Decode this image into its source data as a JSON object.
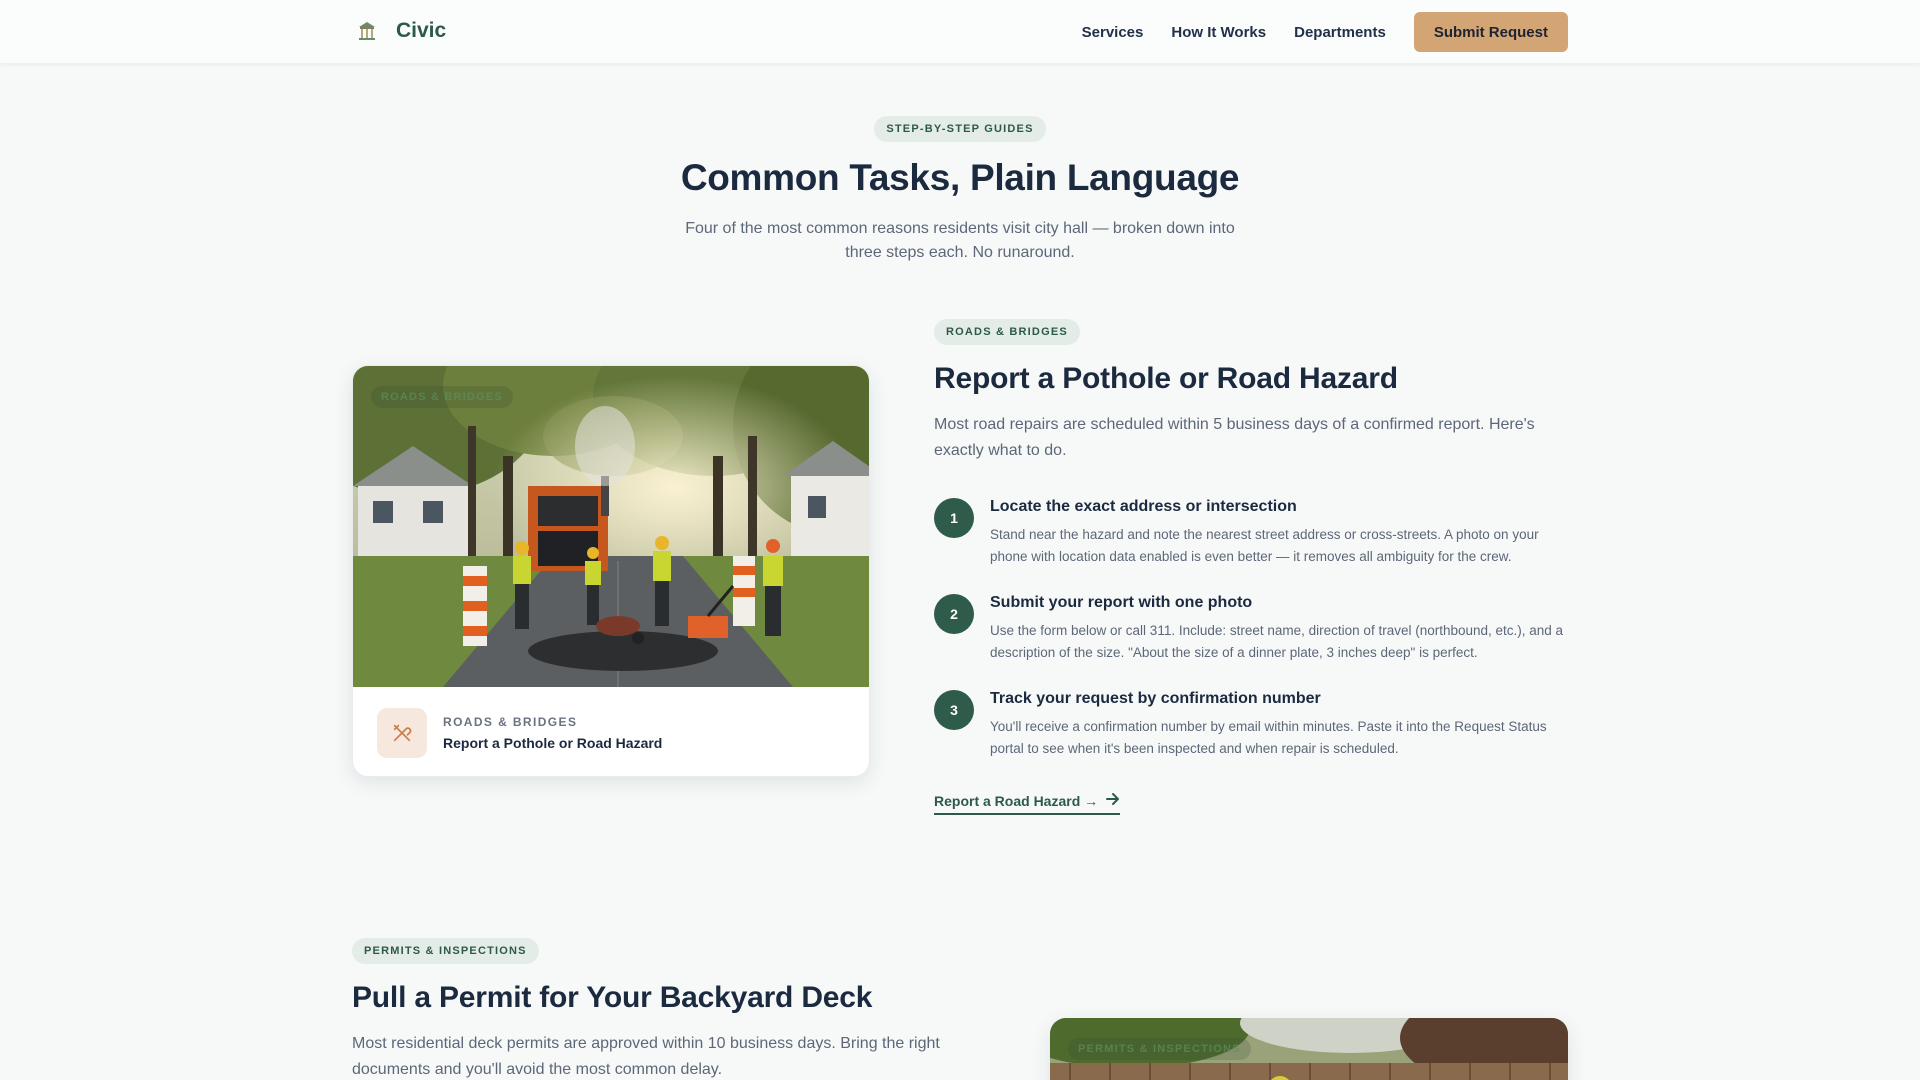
{
  "header": {
    "brand": "Civic",
    "nav": [
      "Services",
      "How It Works",
      "Departments"
    ],
    "cta": "Submit Request"
  },
  "intro": {
    "pill": "STEP-BY-STEP GUIDES",
    "title": "Common Tasks, Plain Language",
    "subtitle": "Four of the most common reasons residents visit city hall — broken down into three steps each. No runaround."
  },
  "task1": {
    "category": "ROADS & BRIDGES",
    "image_tag": "ROADS & BRIDGES",
    "card_category": "ROADS & BRIDGES",
    "card_title": "Report a Pothole or Road Hazard",
    "title": "Report a Pothole or Road Hazard",
    "lead": "Most road repairs are scheduled within 5 business days of a confirmed report. Here's exactly what to do.",
    "steps": [
      {
        "num": "1",
        "title": "Locate the exact address or intersection",
        "text": "Stand near the hazard and note the nearest street address or cross-streets. A photo on your phone with location data enabled is even better — it removes all ambiguity for the crew."
      },
      {
        "num": "2",
        "title": "Submit your report with one photo",
        "text": "Use the form below or call 311. Include: street name, direction of travel (northbound, etc.), and a description of the size. \"About the size of a dinner plate, 3 inches deep\" is perfect."
      },
      {
        "num": "3",
        "title": "Track your request by confirmation number",
        "text": "You'll receive a confirmation number by email within minutes. Paste it into the Request Status portal to see when it's been inspected and when repair is scheduled."
      }
    ],
    "cta": "Report a Road Hazard →"
  },
  "task2": {
    "category": "PERMITS & INSPECTIONS",
    "image_tag": "PERMITS & INSPECTIONS",
    "title": "Pull a Permit for Your Backyard Deck",
    "lead": "Most residential deck permits are approved within 10 business days. Bring the right documents and you'll avoid the most common delay."
  },
  "colors": {
    "primary_green": "#2e5b4a",
    "accent_tan": "#d4a574",
    "heading": "#1c2a40",
    "body_text": "#5d6778"
  },
  "icons": {
    "brand": "city-hall-icon",
    "card": "tools-icon",
    "cta": "arrow-right-icon"
  }
}
